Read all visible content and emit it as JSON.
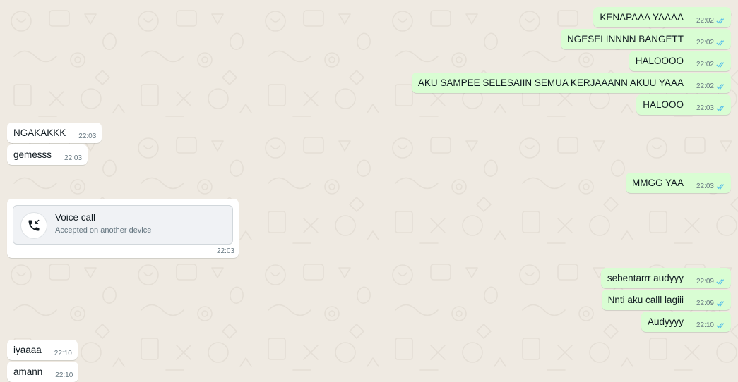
{
  "colors": {
    "background": "#efeae2",
    "outgoing_bubble": "#d9fdd3",
    "incoming_bubble": "#ffffff",
    "read_ticks": "#53bdeb",
    "meta_text": "#667781"
  },
  "messages": [
    {
      "direction": "outgoing",
      "text": "KENAPAAA YAAAA",
      "time": "22:02",
      "status": "read"
    },
    {
      "direction": "outgoing",
      "text": "NGESELINNNN BANGETT",
      "time": "22:02",
      "status": "read"
    },
    {
      "direction": "outgoing",
      "text": "HALOOOO",
      "time": "22:02",
      "status": "read"
    },
    {
      "direction": "outgoing",
      "text": "AKU SAMPEE SELESAIIN SEMUA KERJAAANN AKUU YAAA",
      "time": "22:02",
      "status": "read"
    },
    {
      "direction": "outgoing",
      "text": "HALOOO",
      "time": "22:03",
      "status": "read"
    },
    {
      "direction": "incoming",
      "text": "NGAKAKKK",
      "time": "22:03"
    },
    {
      "direction": "incoming",
      "text": "gemesss",
      "time": "22:03"
    },
    {
      "direction": "outgoing",
      "text": "MMGG YAA",
      "time": "22:03",
      "status": "read"
    },
    {
      "direction": "outgoing",
      "text": "sebentarrr audyyy",
      "time": "22:09",
      "status": "read"
    },
    {
      "direction": "outgoing",
      "text": "Nnti aku calll lagiii",
      "time": "22:09",
      "status": "read"
    },
    {
      "direction": "outgoing",
      "text": "Audyyyy",
      "time": "22:10",
      "status": "read"
    },
    {
      "direction": "incoming",
      "text": "iyaaaa",
      "time": "22:10"
    },
    {
      "direction": "incoming",
      "text": "amann",
      "time": "22:10"
    }
  ],
  "call": {
    "title": "Voice call",
    "subtitle": "Accepted on another device",
    "time": "22:03",
    "icon": "incoming-call-icon"
  }
}
